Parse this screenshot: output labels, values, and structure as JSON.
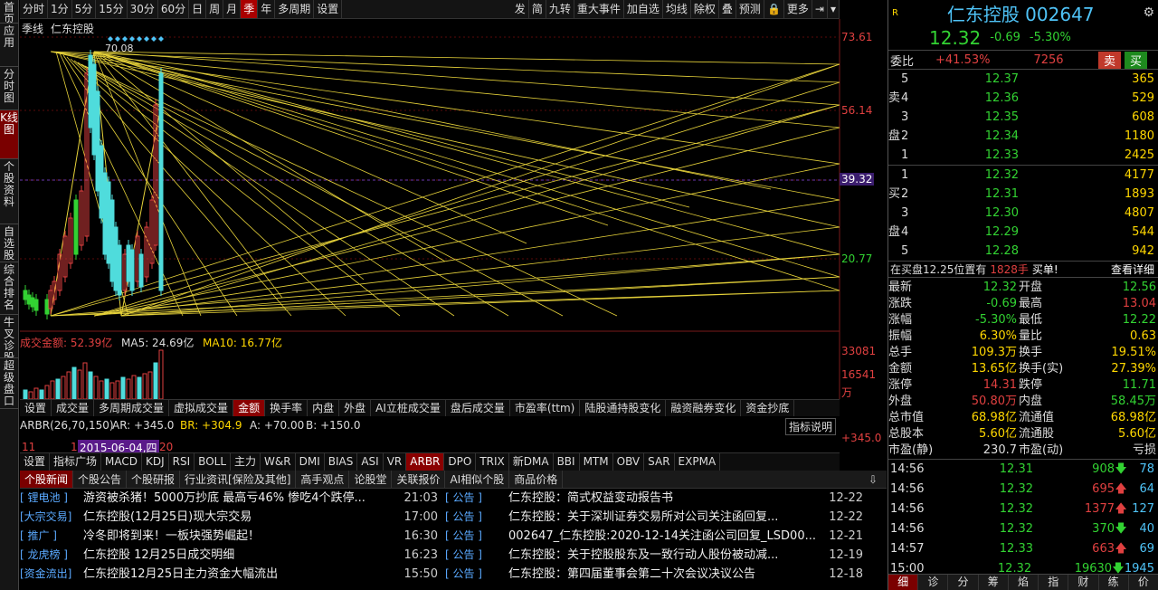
{
  "sidebar": [
    "首页",
    "应用",
    "分时图",
    "K线图",
    "个股资料",
    "自选股",
    "综合排名",
    "牛叉诊股",
    "超级盘口"
  ],
  "toolbar": {
    "periods": [
      "分时",
      "1分",
      "5分",
      "15分",
      "30分",
      "60分",
      "日",
      "周",
      "月",
      "季",
      "年",
      "多周期",
      "设置"
    ],
    "active": "季",
    "right": [
      "发",
      "简",
      "九转",
      "重大事件",
      "加自选",
      "均线",
      "除权",
      "叠",
      "预测",
      "",
      "更多",
      "",
      ""
    ]
  },
  "chart": {
    "period_label": "季线",
    "stock": "仁东控股",
    "y_labels": [
      "73.61",
      "56.14",
      "39.32",
      "20.77"
    ],
    "current_label": "39.32",
    "high_label": "70.08",
    "vol_labels": [
      "33081",
      "16541",
      "万"
    ],
    "amount": "成交金额: 52.39亿",
    "ma5": "MA5: 24.69亿",
    "ma10": "MA10: 16.77亿"
  },
  "chart_data": {
    "type": "candlestick",
    "title": "仁东控股 季线",
    "yticks": [
      73.61,
      56.14,
      39.32,
      20.77
    ],
    "ylim": [
      7,
      75
    ],
    "high": 70.08,
    "current": 39.32,
    "volume_ticks": [
      33081,
      16541
    ],
    "volume_unit": "万",
    "amount": "52.39亿",
    "ma5": "24.69亿",
    "ma10": "16.77亿"
  },
  "indicator_tabs": [
    "设置",
    "成交量",
    "多周期成交量",
    "虚拟成交量",
    "金额",
    "换手率",
    "内盘",
    "外盘",
    "AI立桩成交量",
    "盘后成交量",
    "市盈率(ttm)",
    "陆股通持股变化",
    "融资融券变化",
    "资金抄底"
  ],
  "indicator_active": "金额",
  "arbr": {
    "label": "ARBR(26,70,150)",
    "ar": "AR: +345.0",
    "br": "BR: +304.9",
    "a": "A: +70.00",
    "b": "B: +150.0",
    "explain": "指标说明",
    "right_val": "+345.0",
    "date": "2015-06-04,四",
    "x_labels": [
      "11",
      "1",
      "20"
    ]
  },
  "bottom_tabs": [
    "设置",
    "指标广场",
    "MACD",
    "KDJ",
    "RSI",
    "BOLL",
    "主力",
    "W&R",
    "DMI",
    "BIAS",
    "ASI",
    "VR",
    "ARBR",
    "DPO",
    "TRIX",
    "新DMA",
    "BBI",
    "MTM",
    "OBV",
    "SAR",
    "EXPMA"
  ],
  "bottom_active": "ARBR",
  "news_tabs": [
    "个股新闻",
    "个股公告",
    "个股研报",
    "行业资讯[保险及其他]",
    "高手观点",
    "论股堂",
    "关联报价",
    "AI相似个股",
    "商品价格"
  ],
  "news_left": [
    {
      "tag": "[ 锂电池 ]",
      "title": "游资被杀猪！5000万抄底 最高亏46% 惨吃4个跌停...",
      "time": "21:03"
    },
    {
      "tag": "[大宗交易]",
      "title": "仁东控股(12月25日)现大宗交易",
      "time": "17:00"
    },
    {
      "tag": "[ 推广 ]",
      "title": "冷冬即将到来！一板块强势崛起！",
      "time": "16:30"
    },
    {
      "tag": "[ 龙虎榜 ]",
      "title": "仁东控股 12月25日成交明细",
      "time": "16:23"
    },
    {
      "tag": "[资金流出]",
      "title": "仁东控股12月25日主力资金大幅流出",
      "time": "15:50"
    }
  ],
  "news_right": [
    {
      "tag": "[ 公告 ]",
      "title": "仁东控股：简式权益变动报告书",
      "time": "12-22"
    },
    {
      "tag": "[ 公告 ]",
      "title": "仁东控股：关于深圳证券交易所对公司关注函回复...",
      "time": "12-22"
    },
    {
      "tag": "[ 公告 ]",
      "title": "002647_仁东控股:2020-12-14关注函公司回复_LSD00...",
      "time": "12-21"
    },
    {
      "tag": "[ 公告 ]",
      "title": "仁东控股：关于控股股东及一致行动人股份被动减...",
      "time": "12-19"
    },
    {
      "tag": "[ 公告 ]",
      "title": "仁东控股：第四届董事会第二十次会议决议公告",
      "time": "12-18"
    }
  ],
  "quote": {
    "name": "仁东控股 002647",
    "price": "12.32",
    "change": "-0.69",
    "pct": "-5.30%",
    "weibi_label": "委比",
    "weibi": "+41.53%",
    "weicha": "7256",
    "sell": "卖",
    "buy": "买"
  },
  "asks": [
    {
      "lv": "5",
      "p": "12.37",
      "v": "365"
    },
    {
      "lv": "4",
      "p": "12.36",
      "v": "529"
    },
    {
      "lv": "3",
      "p": "12.35",
      "v": "608"
    },
    {
      "lv": "2",
      "p": "12.34",
      "v": "1180"
    },
    {
      "lv": "1",
      "p": "12.33",
      "v": "2425"
    }
  ],
  "bids": [
    {
      "lv": "1",
      "p": "12.32",
      "v": "4177"
    },
    {
      "lv": "2",
      "p": "12.31",
      "v": "1893"
    },
    {
      "lv": "3",
      "p": "12.30",
      "v": "4807"
    },
    {
      "lv": "4",
      "p": "12.29",
      "v": "544"
    },
    {
      "lv": "5",
      "p": "12.28",
      "v": "942"
    }
  ],
  "ask_side": [
    "卖",
    "盘"
  ],
  "bid_side": [
    "买",
    "盘"
  ],
  "notice": {
    "text": "在买盘12.25位置有",
    "vol": "1828手",
    "buy": "买单!",
    "detail": "查看详细"
  },
  "stats": [
    [
      "最新",
      "12.32",
      "开盘",
      "12.56"
    ],
    [
      "涨跌",
      "-0.69",
      "最高",
      "13.04"
    ],
    [
      "涨幅",
      "-5.30%",
      "最低",
      "12.22"
    ],
    [
      "振幅",
      "6.30%",
      "量比",
      "0.63"
    ],
    [
      "总手",
      "109.3万",
      "换手",
      "19.51%"
    ],
    [
      "金额",
      "13.65亿",
      "换手(实)",
      "27.39%"
    ],
    [
      "涨停",
      "14.31",
      "跌停",
      "11.71"
    ],
    [
      "外盘",
      "50.80万",
      "内盘",
      "58.45万"
    ],
    [
      "总市值",
      "68.98亿",
      "流通值",
      "68.98亿"
    ],
    [
      "总股本",
      "5.60亿",
      "流通股",
      "5.60亿"
    ],
    [
      "市盈(静)",
      "230.7",
      "市盈(动)",
      "亏损"
    ]
  ],
  "ticks": [
    {
      "t": "14:56",
      "p": "12.31",
      "v": "908",
      "d": "down",
      "n": "78"
    },
    {
      "t": "14:56",
      "p": "12.32",
      "v": "695",
      "d": "up",
      "n": "64"
    },
    {
      "t": "14:56",
      "p": "12.32",
      "v": "1377",
      "d": "up",
      "n": "127"
    },
    {
      "t": "14:56",
      "p": "12.32",
      "v": "370",
      "d": "down",
      "n": "40"
    },
    {
      "t": "14:57",
      "p": "12.33",
      "v": "663",
      "d": "up",
      "n": "69"
    },
    {
      "t": "15:00",
      "p": "12.32",
      "v": "19630",
      "d": "down",
      "n": "1945"
    }
  ],
  "right_tabs": [
    "细",
    "诊",
    "分",
    "筹",
    "焰",
    "指",
    "财",
    "练",
    "价"
  ]
}
